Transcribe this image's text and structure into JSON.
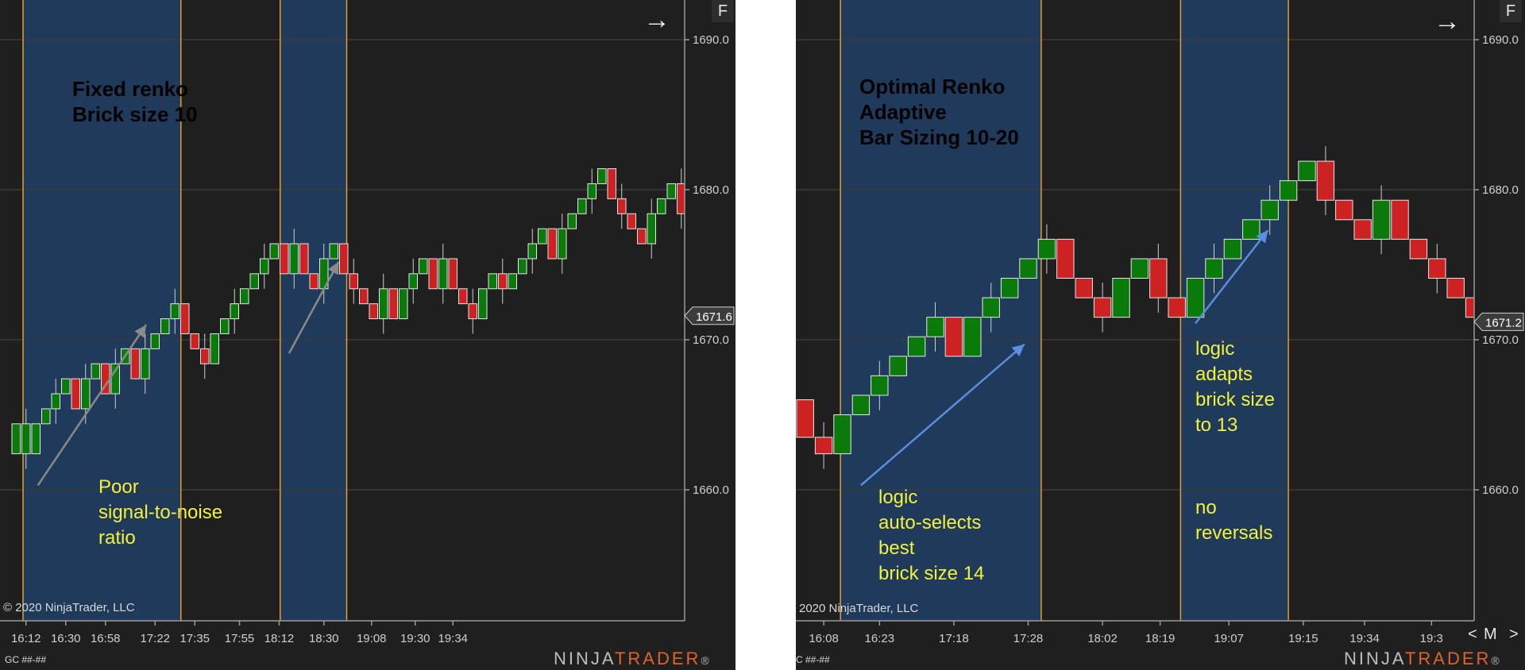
{
  "colors": {
    "bg": "#1f1f1f",
    "shade": "#1f3a5a",
    "vline": "#e0a030",
    "up": "#0a7a0a",
    "down": "#cc2222",
    "grid": "#3a3a3a"
  },
  "left": {
    "title": "Fixed renko\nBrick size 10",
    "title_color": "#c8c8c8",
    "annotation": "Poor\nsignal-to-noise\nratio",
    "copyright": "© 2020 NinjaTrader, LLC",
    "instrument": "GC ##-##",
    "f_button": "F",
    "arrow_icon": "→",
    "brand_ninja": "NINJA",
    "brand_trader": "TRADER",
    "brand_reg": "®"
  },
  "right": {
    "title": "Optimal Renko\nAdaptive\nBar Sizing 10-20",
    "title_color": "#2f8ff0",
    "annotation_1": "logic\nauto-selects\nbest\nbrick size 14",
    "annotation_2": "logic\nadapts\nbrick size\nto 13",
    "annotation_3": "no\nreversals",
    "copyright": "2020 NinjaTrader, LLC",
    "instrument": "C ##-##",
    "f_button": "F",
    "arrow_icon": "→",
    "nav_prev": "<",
    "nav_mode": "M",
    "nav_next": ">",
    "brand_ninja": "NINJA",
    "brand_trader": "TRADER",
    "brand_reg": "®"
  },
  "chart_data": [
    {
      "type": "candlestick",
      "title": "Fixed renko\nBrick size 10",
      "ylim": [
        1654,
        1694
      ],
      "yticks": [
        1660.0,
        1670.0,
        1680.0,
        1690.0
      ],
      "ytick_labels": [
        "1660.0",
        "1670.0",
        "1680.0",
        "1690.0"
      ],
      "last_price_label": "1671.6",
      "last_price": 1671.6,
      "xlim": [
        0,
        43
      ],
      "x_tick_labels": [
        "16:12",
        "16:30",
        "16:58",
        "17:22",
        "17:35",
        "17:55",
        "18:12",
        "18:30",
        "19:08",
        "19:30",
        "19:34"
      ],
      "x_tick_positions": [
        1.5,
        5.5,
        9.5,
        14.5,
        18.5,
        23,
        27,
        31.5,
        36.3,
        40.7,
        44.5
      ],
      "shaded_ranges": [
        [
          1.2,
          17.1
        ],
        [
          27.1,
          33.8
        ]
      ],
      "vlines": [
        1.2,
        17.1,
        27.1,
        33.8
      ],
      "bricks": [
        {
          "o": 1662.4,
          "c": 1664.4
        },
        {
          "o": 1662.4,
          "c": 1664.4
        },
        {
          "o": 1662.4,
          "c": 1664.4
        },
        {
          "o": 1664.4,
          "c": 1665.4
        },
        {
          "o": 1665.4,
          "c": 1666.4
        },
        {
          "o": 1666.4,
          "c": 1667.4
        },
        {
          "o": 1667.4,
          "c": 1665.4
        },
        {
          "o": 1665.4,
          "c": 1667.4
        },
        {
          "o": 1667.4,
          "c": 1668.4
        },
        {
          "o": 1668.4,
          "c": 1666.4
        },
        {
          "o": 1666.4,
          "c": 1668.4
        },
        {
          "o": 1668.4,
          "c": 1669.4
        },
        {
          "o": 1669.4,
          "c": 1667.4
        },
        {
          "o": 1667.4,
          "c": 1669.4
        },
        {
          "o": 1669.4,
          "c": 1670.4
        },
        {
          "o": 1670.4,
          "c": 1671.4
        },
        {
          "o": 1671.4,
          "c": 1672.4
        },
        {
          "o": 1672.4,
          "c": 1670.4
        },
        {
          "o": 1670.4,
          "c": 1669.4
        },
        {
          "o": 1669.4,
          "c": 1668.4
        },
        {
          "o": 1668.4,
          "c": 1670.4
        },
        {
          "o": 1670.4,
          "c": 1671.4
        },
        {
          "o": 1671.4,
          "c": 1672.4
        },
        {
          "o": 1672.4,
          "c": 1673.4
        },
        {
          "o": 1673.4,
          "c": 1674.4
        },
        {
          "o": 1674.4,
          "c": 1675.4
        },
        {
          "o": 1675.4,
          "c": 1676.4
        },
        {
          "o": 1676.4,
          "c": 1674.4
        },
        {
          "o": 1674.4,
          "c": 1676.4
        },
        {
          "o": 1676.4,
          "c": 1674.4
        },
        {
          "o": 1674.4,
          "c": 1673.4
        },
        {
          "o": 1673.4,
          "c": 1675.4
        },
        {
          "o": 1675.4,
          "c": 1676.4
        },
        {
          "o": 1676.4,
          "c": 1674.4
        },
        {
          "o": 1674.4,
          "c": 1673.4
        },
        {
          "o": 1673.4,
          "c": 1672.4
        },
        {
          "o": 1672.4,
          "c": 1671.4
        },
        {
          "o": 1671.4,
          "c": 1673.4
        },
        {
          "o": 1673.4,
          "c": 1671.4
        },
        {
          "o": 1671.4,
          "c": 1673.4
        },
        {
          "o": 1673.4,
          "c": 1674.4
        },
        {
          "o": 1674.4,
          "c": 1675.4
        },
        {
          "o": 1675.4,
          "c": 1673.4
        },
        {
          "o": 1673.4,
          "c": 1675.4
        },
        {
          "o": 1675.4,
          "c": 1673.4
        },
        {
          "o": 1673.4,
          "c": 1672.4
        },
        {
          "o": 1672.4,
          "c": 1671.4
        },
        {
          "o": 1671.4,
          "c": 1673.4
        },
        {
          "o": 1673.4,
          "c": 1674.4
        },
        {
          "o": 1674.4,
          "c": 1673.4
        },
        {
          "o": 1673.4,
          "c": 1674.4
        },
        {
          "o": 1674.4,
          "c": 1675.4
        },
        {
          "o": 1675.4,
          "c": 1676.4
        },
        {
          "o": 1676.4,
          "c": 1677.4
        },
        {
          "o": 1677.4,
          "c": 1675.4
        },
        {
          "o": 1675.4,
          "c": 1677.4
        },
        {
          "o": 1677.4,
          "c": 1678.4
        },
        {
          "o": 1678.4,
          "c": 1679.4
        },
        {
          "o": 1679.4,
          "c": 1680.4
        },
        {
          "o": 1680.4,
          "c": 1681.4
        },
        {
          "o": 1681.4,
          "c": 1679.4
        },
        {
          "o": 1679.4,
          "c": 1678.4
        },
        {
          "o": 1678.4,
          "c": 1677.4
        },
        {
          "o": 1677.4,
          "c": 1676.4
        },
        {
          "o": 1676.4,
          "c": 1678.4
        },
        {
          "o": 1678.4,
          "c": 1679.4
        },
        {
          "o": 1679.4,
          "c": 1680.4
        },
        {
          "o": 1680.4,
          "c": 1678.4
        },
        {
          "o": 1678.4,
          "c": 1677.4
        },
        {
          "o": 1677.4,
          "c": 1676.4
        },
        {
          "o": 1676.4,
          "c": 1675.4
        },
        {
          "o": 1675.4,
          "c": 1674.4
        },
        {
          "o": 1674.4,
          "c": 1673.4
        },
        {
          "o": 1673.4,
          "c": 1672.4
        },
        {
          "o": 1672.4,
          "c": 1671.4
        }
      ],
      "arrows": [
        [
          [
            2.7,
            1660.3
          ],
          [
            13.6,
            1671.0
          ]
        ],
        [
          [
            28.0,
            1669.1
          ],
          [
            33.0,
            1675.2
          ]
        ]
      ]
    },
    {
      "type": "candlestick",
      "title": "Optimal Renko\nAdaptive\nBar Sizing 10-20",
      "ylim": [
        1654,
        1694
      ],
      "yticks": [
        1660.0,
        1670.0,
        1680.0,
        1690.0
      ],
      "ytick_labels": [
        "1660.0",
        "1670.0",
        "1680.0",
        "1690.0"
      ],
      "last_price_label": "1671.2",
      "last_price": 1671.2,
      "xlim": [
        0,
        29
      ],
      "x_tick_labels": [
        "16:08",
        "16:23",
        "17:18",
        "17:28",
        "18:02",
        "18:19",
        "19:07",
        "19:15",
        "19:34",
        "19:3"
      ],
      "x_tick_positions": [
        1.5,
        4.5,
        8.5,
        12.5,
        16.5,
        19.6,
        23.3,
        27.3,
        30.6,
        34.2
      ],
      "shaded_ranges": [
        [
          2.4,
          13.2
        ],
        [
          20.7,
          26.5
        ]
      ],
      "vlines": [
        2.4,
        13.2,
        20.7,
        26.5
      ],
      "bricks": [
        {
          "o": 1666.0,
          "c": 1663.5
        },
        {
          "o": 1663.5,
          "c": 1662.4
        },
        {
          "o": 1662.4,
          "c": 1665.0
        },
        {
          "o": 1665.0,
          "c": 1666.3
        },
        {
          "o": 1666.3,
          "c": 1667.6
        },
        {
          "o": 1667.6,
          "c": 1668.9
        },
        {
          "o": 1668.9,
          "c": 1670.2
        },
        {
          "o": 1670.2,
          "c": 1671.5
        },
        {
          "o": 1671.5,
          "c": 1668.9
        },
        {
          "o": 1668.9,
          "c": 1671.5
        },
        {
          "o": 1671.5,
          "c": 1672.8
        },
        {
          "o": 1672.8,
          "c": 1674.1
        },
        {
          "o": 1674.1,
          "c": 1675.4
        },
        {
          "o": 1675.4,
          "c": 1676.7
        },
        {
          "o": 1676.7,
          "c": 1674.1
        },
        {
          "o": 1674.1,
          "c": 1672.8
        },
        {
          "o": 1672.8,
          "c": 1671.5
        },
        {
          "o": 1671.5,
          "c": 1674.1
        },
        {
          "o": 1674.1,
          "c": 1675.4
        },
        {
          "o": 1675.4,
          "c": 1672.8
        },
        {
          "o": 1672.8,
          "c": 1671.5
        },
        {
          "o": 1671.5,
          "c": 1674.1
        },
        {
          "o": 1674.1,
          "c": 1675.4
        },
        {
          "o": 1675.4,
          "c": 1676.7
        },
        {
          "o": 1676.7,
          "c": 1678.0
        },
        {
          "o": 1678.0,
          "c": 1679.3
        },
        {
          "o": 1679.3,
          "c": 1680.6
        },
        {
          "o": 1680.6,
          "c": 1681.9
        },
        {
          "o": 1681.9,
          "c": 1679.3
        },
        {
          "o": 1679.3,
          "c": 1678.0
        },
        {
          "o": 1678.0,
          "c": 1676.7
        },
        {
          "o": 1676.7,
          "c": 1679.3
        },
        {
          "o": 1679.3,
          "c": 1676.7
        },
        {
          "o": 1676.7,
          "c": 1675.4
        },
        {
          "o": 1675.4,
          "c": 1674.1
        },
        {
          "o": 1674.1,
          "c": 1672.8
        },
        {
          "o": 1672.8,
          "c": 1671.5
        },
        {
          "o": 1671.5,
          "c": 1670.2
        }
      ],
      "arrows": [
        [
          [
            3.5,
            1660.3
          ],
          [
            12.3,
            1669.7
          ]
        ],
        [
          [
            21.5,
            1671.1
          ],
          [
            25.4,
            1677.3
          ]
        ]
      ]
    }
  ]
}
